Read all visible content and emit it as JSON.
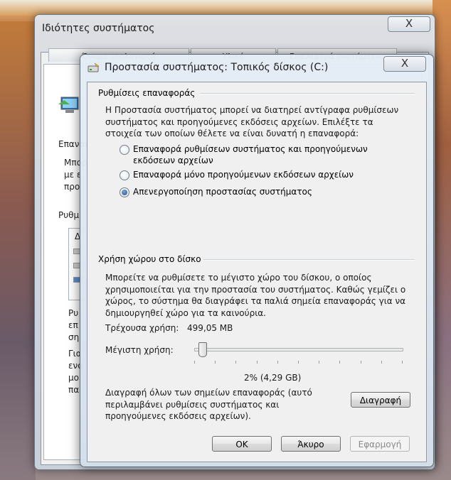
{
  "back_window": {
    "title": "Ιδιότητες συστήματος",
    "close_glyph": "X",
    "tabs": [
      "Όνομα υπολογιστή",
      "Υλικό",
      "Επαναφορά συστήματος"
    ],
    "fragments": [
      "Επαναφ",
      "Μπορ",
      "με ε",
      "προ",
      "Ρυθμ",
      "Δ",
      "Ρυ",
      "επ",
      "ση",
      "Για",
      "ενα",
      "μο",
      "πα"
    ]
  },
  "dialog": {
    "title": "Προστασία συστήματος: Τοπικός δίσκος (C:)",
    "close_glyph": "X",
    "restore_settings": {
      "heading": "Ρυθμίσεις επαναφοράς",
      "description": "Η Προστασία συστήματος μπορεί να διατηρεί αντίγραφα ρυθμίσεων συστήματος και προηγούμενες εκδόσεις αρχείων. Επιλέξτε τα στοιχεία των οποίων θέλετε να είναι δυνατή η επαναφορά:",
      "options": [
        {
          "label": "Επαναφορά ρυθμίσεων συστήματος και προηγούμενων εκδόσεων αρχείων",
          "checked": false
        },
        {
          "label": "Επαναφορά μόνο προηγούμενων εκδόσεων αρχείων",
          "checked": false
        },
        {
          "label": "Απενεργοποίηση προστασίας συστήματος",
          "checked": true
        }
      ]
    },
    "disk_usage": {
      "heading": "Χρήση χώρου στο δίσκο",
      "description": "Μπορείτε να ρυθμίσετε το μέγιστο χώρο του δίσκου, ο οποίος χρησιμοποιείται για την προστασία του συστήματος. Καθώς γεμίζει  ο χώρος, το σύστημα θα διαγράφει τα παλιά σημεία επαναφοράς για να δημιουργηθεί χώρο για τα καινούρια.",
      "current_usage_label": "Τρέχουσα χρήση:",
      "current_usage_value": "499,05 MB",
      "max_usage_label": "Μέγιστη χρήση:",
      "slider_percent": 2,
      "slider_readout": "2% (4,29 GB)",
      "delete_description": "Διαγραφή όλων των σημείων επαναφοράς (αυτό περιλαμβάνει ρυθμίσεις συστήματος και προηγούμενες εκδόσεις αρχείων).",
      "delete_button": "Διαγραφή"
    },
    "footer": {
      "ok": "OK",
      "cancel": "Άκυρο",
      "apply": "Εφαρμογή"
    }
  }
}
